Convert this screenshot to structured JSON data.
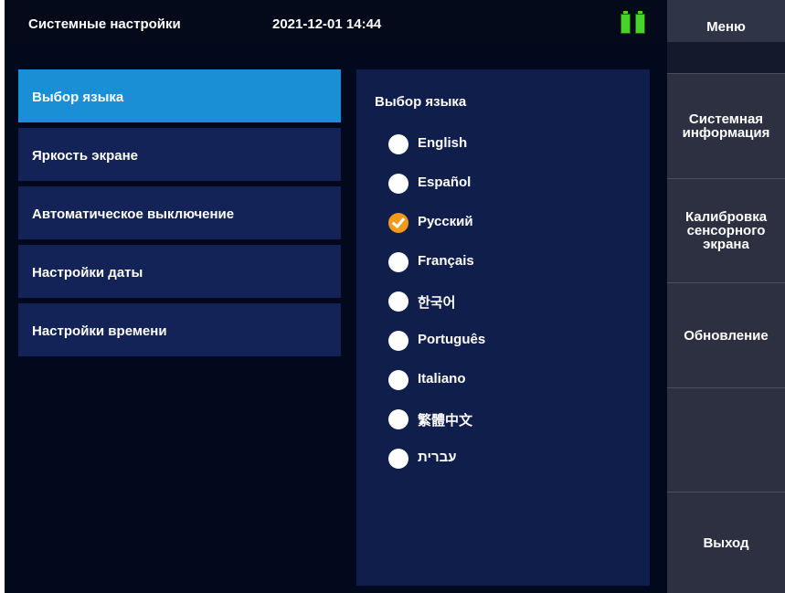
{
  "header": {
    "title": "Системные настройки",
    "datetime": "2021-12-01 14:44",
    "battery_icons": [
      "battery-icon",
      "battery-icon"
    ],
    "battery_color": "#46d42a"
  },
  "settings_menu": {
    "items": [
      {
        "label": "Выбор языка",
        "active": true
      },
      {
        "label": "Яркость экране",
        "active": false
      },
      {
        "label": "Автоматическое выключение",
        "active": false
      },
      {
        "label": "Настройки даты",
        "active": false
      },
      {
        "label": "Настройки времени",
        "active": false
      }
    ],
    "active_color": "#1a8fd5",
    "item_color": "#142357"
  },
  "language_panel": {
    "title": "Выбор языка",
    "selected": "Русский",
    "options": [
      "English",
      "Español",
      "Русский",
      "Français",
      "한국어",
      "Português",
      "Italiano",
      "繁體中文",
      "עברית"
    ],
    "check_color": "#f29a1a"
  },
  "sidebar": {
    "header": "Меню",
    "buttons": [
      {
        "label": "Системная\nинформация"
      },
      {
        "label": "Калибровка\nсенсорного\nэкрана"
      },
      {
        "label": "Обновление"
      },
      {
        "label": ""
      },
      {
        "label": "Выход"
      }
    ]
  }
}
